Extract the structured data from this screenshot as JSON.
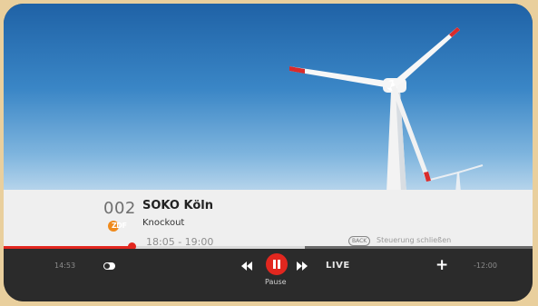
{
  "channel": {
    "number": "002",
    "logo_text": "ZDF",
    "logo_color": "#ef8a1c"
  },
  "program": {
    "title": "SOKO Köln",
    "episode": "Knockout",
    "time_range": "18:05 - 19:00"
  },
  "hint": {
    "back_key": "BACK",
    "text": "Steuerung schließen"
  },
  "progress": {
    "played_fraction": 0.24,
    "buffered_fraction": 0.57
  },
  "controls": {
    "elapsed": "14:53",
    "remaining": "-12:00",
    "pause_label": "Pause",
    "live_label": "LIVE",
    "icons": [
      "toggle-icon",
      "rewind-icon",
      "pause-icon",
      "fast-forward-icon",
      "plus-icon"
    ]
  },
  "colors": {
    "accent": "#e2271f",
    "frame": "#e9cf9d",
    "info_bg": "#efefef",
    "controls_bg": "#2b2b2b"
  }
}
